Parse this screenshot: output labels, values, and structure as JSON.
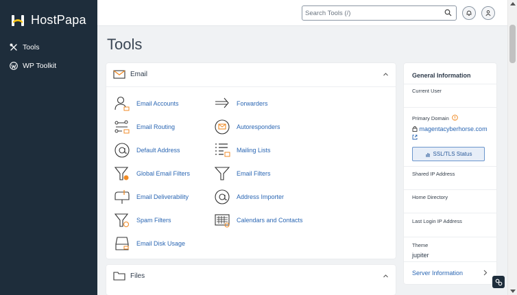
{
  "sidebar": {
    "brand": "HostPapa",
    "items": [
      {
        "label": "Tools",
        "icon": "tools-icon"
      },
      {
        "label": "WP Toolkit",
        "icon": "wordpress-icon"
      }
    ]
  },
  "header": {
    "search_placeholder": "Search Tools (/)",
    "search_value": ""
  },
  "main": {
    "title": "Tools",
    "email": {
      "title": "Email",
      "tools": [
        {
          "label": "Email Accounts",
          "icon": "email-accounts-icon"
        },
        {
          "label": "Forwarders",
          "icon": "forwarders-icon"
        },
        {
          "label": "Email Routing",
          "icon": "email-routing-icon"
        },
        {
          "label": "Autoresponders",
          "icon": "autoresponders-icon"
        },
        {
          "label": "Default Address",
          "icon": "default-address-icon"
        },
        {
          "label": "Mailing Lists",
          "icon": "mailing-lists-icon"
        },
        {
          "label": "Global Email Filters",
          "icon": "global-email-filters-icon"
        },
        {
          "label": "Email Filters",
          "icon": "email-filters-icon"
        },
        {
          "label": "Email Deliverability",
          "icon": "email-deliverability-icon"
        },
        {
          "label": "Address Importer",
          "icon": "address-importer-icon"
        },
        {
          "label": "Spam Filters",
          "icon": "spam-filters-icon"
        },
        {
          "label": "Calendars and Contacts",
          "icon": "calendars-contacts-icon"
        },
        {
          "label": "Email Disk Usage",
          "icon": "email-disk-usage-icon"
        }
      ]
    },
    "files": {
      "title": "Files"
    }
  },
  "general_info": {
    "title": "General Information",
    "current_user_label": "Current User",
    "primary_domain_label": "Primary Domain",
    "primary_domain": "magentacyberhorse.com",
    "ssl_button": "SSL/TLS Status",
    "shared_ip_label": "Shared IP Address",
    "home_directory_label": "Home Directory",
    "last_login_label": "Last Login IP Address",
    "theme_label": "Theme",
    "theme_value": "jupiter",
    "server_info": "Server Information"
  },
  "colors": {
    "sidebar_bg": "#1e2d3b",
    "link": "#2a66b3",
    "accent_orange": "#f08a24",
    "logo_yellow": "#f6c418"
  }
}
